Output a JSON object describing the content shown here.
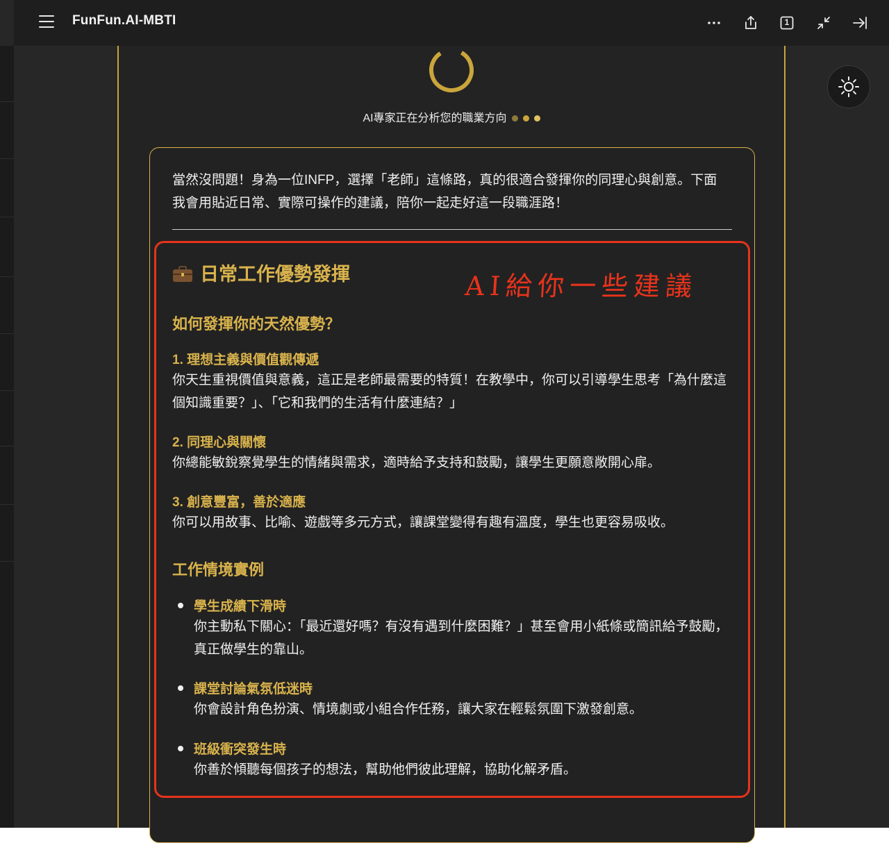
{
  "app": {
    "title": "FunFun.AI-MBTI"
  },
  "toolbar": {
    "icons": [
      "menu-icon",
      "more-icon",
      "share-icon",
      "page-count-icon",
      "collapse-icon",
      "sidebar-close-icon"
    ],
    "page_count": "1"
  },
  "status": {
    "analyzing_text": "AI專家正在分析您的職業方向"
  },
  "colors": {
    "accent_gold": "#c9a53c",
    "annotation_red": "#e8331c",
    "background": "#232323"
  },
  "response": {
    "intro": "當然沒問題！身為一位INFP，選擇「老師」這條路，真的很適合發揮你的同理心與創意。下面我會用貼近日常、實際可操作的建議，陪你一起走好這一段職涯路！",
    "section_title": "日常工作優勢發揮",
    "annotation": "AI給你一些建議",
    "strengths_heading": "如何發揮你的天然優勢？",
    "strengths": [
      {
        "title": "1. 理想主義與價值觀傳遞",
        "text": "你天生重視價值與意義，這正是老師最需要的特質！在教學中，你可以引導學生思考「為什麼這個知識重要？」、「它和我們的生活有什麼連結？」"
      },
      {
        "title": "2. 同理心與關懷",
        "text": "你總能敏銳察覺學生的情緒與需求，適時給予支持和鼓勵，讓學生更願意敞開心扉。"
      },
      {
        "title": "3. 創意豐富，善於適應",
        "text": "你可以用故事、比喻、遊戲等多元方式，讓課堂變得有趣有溫度，學生也更容易吸收。"
      }
    ],
    "examples_heading": "工作情境實例",
    "examples": [
      {
        "title": "學生成績下滑時",
        "text": "你主動私下關心：「最近還好嗎？有沒有遇到什麼困難？」甚至會用小紙條或簡訊給予鼓勵，真正做學生的靠山。"
      },
      {
        "title": "課堂討論氣氛低迷時",
        "text": "你會設計角色扮演、情境劇或小組合作任務，讓大家在輕鬆氛圍下激發創意。"
      },
      {
        "title": "班級衝突發生時",
        "text": "你善於傾聽每個孩子的想法，幫助他們彼此理解，協助化解矛盾。"
      }
    ]
  }
}
